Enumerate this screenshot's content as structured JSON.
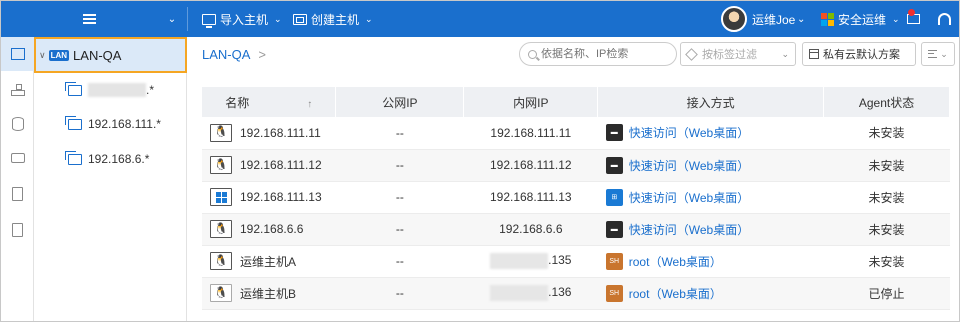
{
  "topbar": {
    "import_label": "导入主机",
    "create_label": "创建主机",
    "user_name": "运维Joe",
    "safe_ops_label": "安全运维",
    "brand_colors": {
      "bar": "#1a6fcd",
      "notify": "#f23030"
    }
  },
  "tree": {
    "root_badge": "LAN",
    "root_label": "LAN-QA",
    "nodes": [
      {
        "label": ".*",
        "masked": true
      },
      {
        "label": "192.168.111.*"
      },
      {
        "label": "192.168.6.*"
      }
    ]
  },
  "main": {
    "breadcrumb": "LAN-QA",
    "breadcrumb_sep": ">",
    "search_placeholder": "依据名称、IP检索",
    "tag_filter_placeholder": "按标签过滤",
    "cloud_scheme": "私有云默认方案"
  },
  "table": {
    "headers": {
      "name": "名称",
      "sort_arrow": "↑",
      "public_ip": "公网IP",
      "private_ip": "内网IP",
      "access": "接入方式",
      "agent": "Agent状态"
    },
    "rows": [
      {
        "name": "192.168.111.11",
        "os": "linux",
        "public_ip": "--",
        "private_ip": "192.168.111.11",
        "access": "快速访问（Web桌面）",
        "access_type": "terminal",
        "agent": "未安装"
      },
      {
        "name": "192.168.111.12",
        "os": "linux",
        "public_ip": "--",
        "private_ip": "192.168.111.12",
        "access": "快速访问（Web桌面）",
        "access_type": "terminal",
        "agent": "未安装"
      },
      {
        "name": "192.168.111.13",
        "os": "windows",
        "public_ip": "--",
        "private_ip": "192.168.111.13",
        "access": "快速访问（Web桌面）",
        "access_type": "windows",
        "agent": "未安装"
      },
      {
        "name": "192.168.6.6",
        "os": "linux",
        "public_ip": "--",
        "private_ip": "192.168.6.6",
        "access": "快速访问（Web桌面）",
        "access_type": "terminal",
        "agent": "未安装"
      },
      {
        "name": "运维主机A",
        "os": "linux",
        "public_ip": "--",
        "private_ip": ".135",
        "private_ip_masked": true,
        "access": "root（Web桌面）",
        "access_type": "ssh",
        "agent": "未安装"
      },
      {
        "name": "运维主机B",
        "os": "linux-dim",
        "public_ip": "--",
        "private_ip": ".136",
        "private_ip_masked": true,
        "access": "root（Web桌面）",
        "access_type": "ssh",
        "agent": "已停止"
      }
    ]
  }
}
